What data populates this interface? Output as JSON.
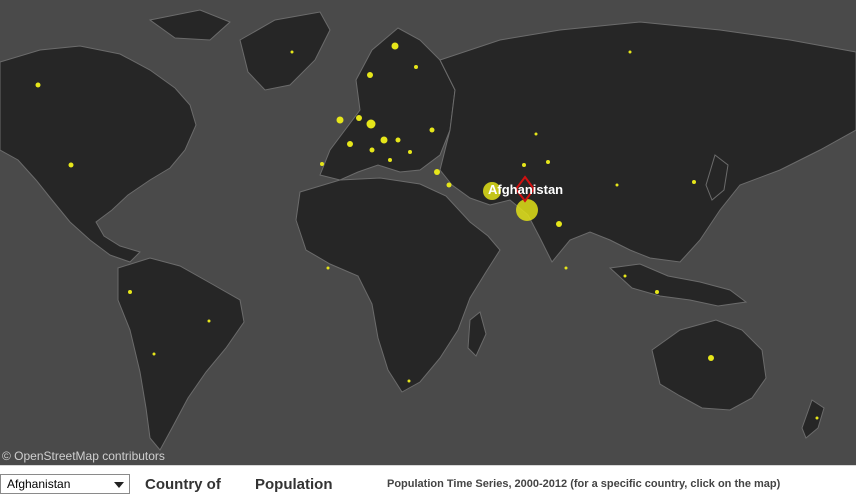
{
  "map": {
    "selected_label": "Afghanistan",
    "attribution": "© OpenStreetMap contributors",
    "colors": {
      "ocean": "#4a4a4a",
      "land": "#262626",
      "borders": "#6b6b6b",
      "marker": "#e6e61a",
      "selection": "#d01010"
    }
  },
  "controls": {
    "country_select": {
      "value": "Afghanistan"
    },
    "country_heading": "Country of",
    "population_heading": "Population",
    "time_series_title": "Population Time Series, 2000-2012 (for a specific country, click on the map)"
  }
}
